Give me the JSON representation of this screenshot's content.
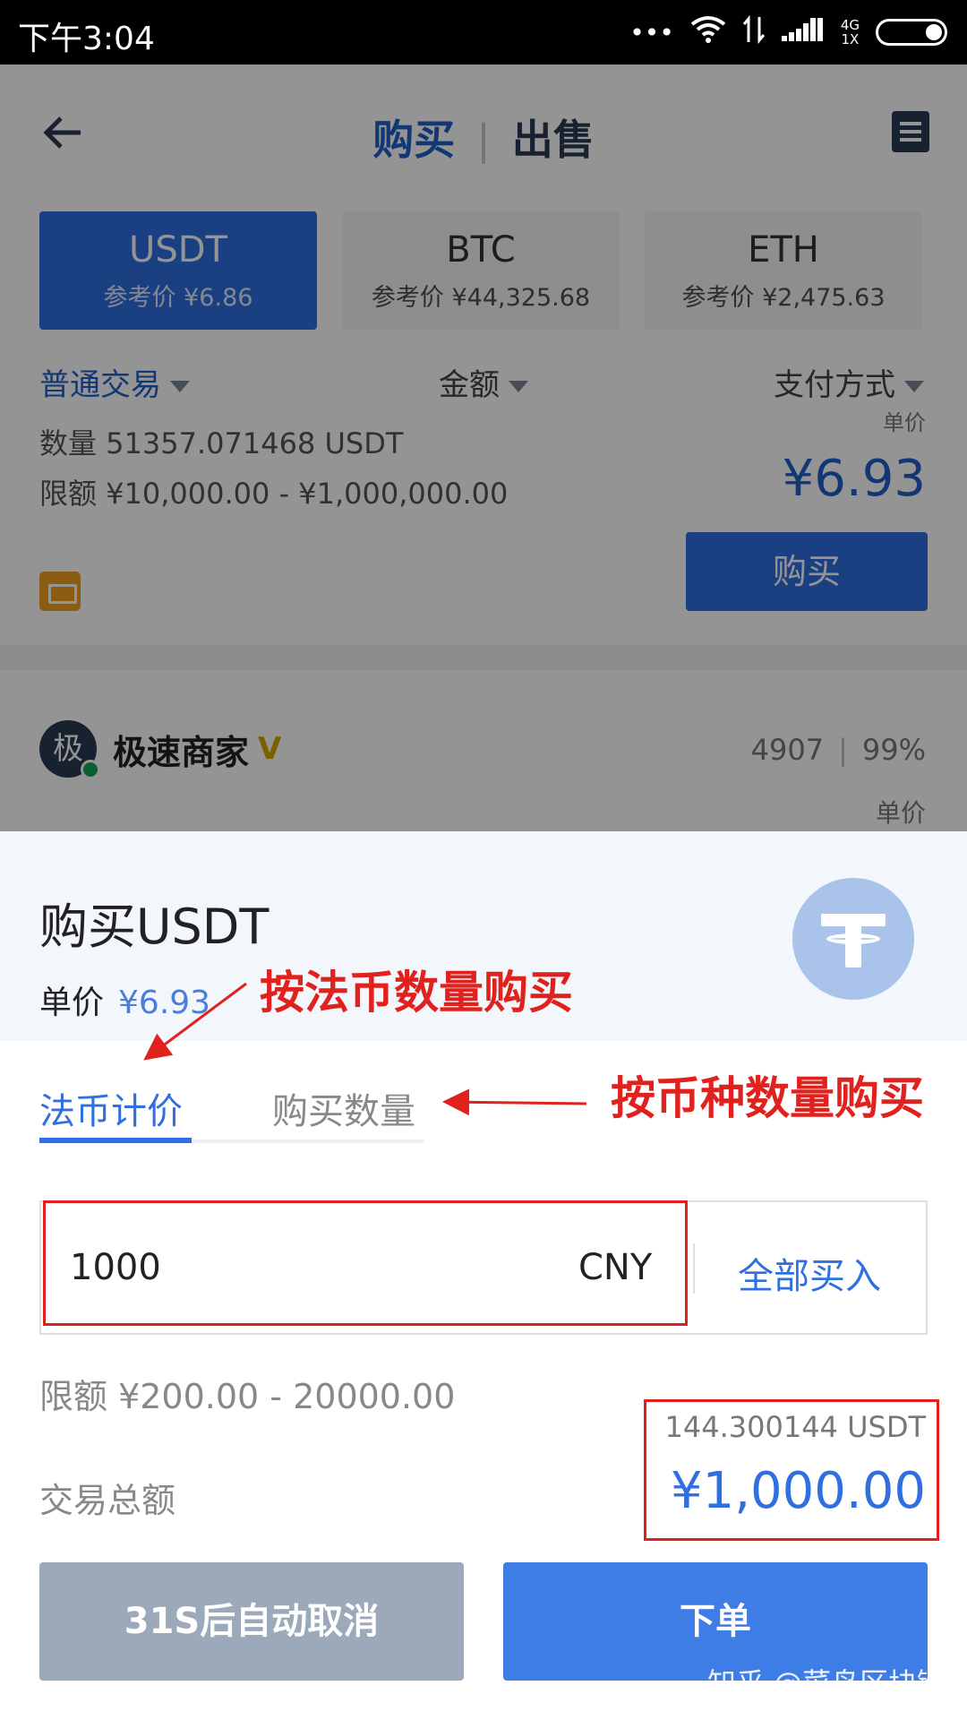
{
  "status_bar": {
    "time": "下午3:04",
    "network_top": "4G",
    "network_bottom": "1X",
    "dots": "•••"
  },
  "header": {
    "buy_tab": "购买",
    "separator": "|",
    "sell_tab": "出售"
  },
  "coins": [
    {
      "symbol": "USDT",
      "ref_price": "参考价 ¥6.86"
    },
    {
      "symbol": "BTC",
      "ref_price": "参考价 ¥44,325.68"
    },
    {
      "symbol": "ETH",
      "ref_price": "参考价 ¥2,475.63"
    }
  ],
  "filters": {
    "trade_type": "普通交易",
    "amount": "金额",
    "payment": "支付方式"
  },
  "ad": {
    "quantity": "数量 51357.071468 USDT",
    "limit": "限额 ¥10,000.00 - ¥1,000,000.00",
    "unit_label": "单价",
    "price": "¥6.93",
    "buy_button": "购买"
  },
  "merchant": {
    "avatar_char": "极",
    "name": "极速商家",
    "badge": "V",
    "orders": "4907",
    "stat_sep": "|",
    "rate": "99%",
    "unit_label": "单价"
  },
  "sheet": {
    "title": "购买USDT",
    "unit_price_label": "单价",
    "unit_price": "¥6.93",
    "tab_fiat": "法币计价",
    "tab_qty": "购买数量",
    "amount_value": "1000",
    "currency": "CNY",
    "buy_all": "全部买入",
    "limit": "限额 ¥200.00 - 20000.00",
    "usdt_amount": "144.300144 USDT",
    "total_label": "交易总额",
    "total_value": "¥1,000.00",
    "cancel_button": "31S后自动取消",
    "order_button": "下单"
  },
  "annotations": {
    "by_fiat": "按法币数量购买",
    "by_coin": "按币种数量购买"
  },
  "watermark": "知乎 @菜鸟区块链",
  "colors": {
    "accent": "#2f6fe0",
    "annotation_red": "#e0221f",
    "cancel_gray": "#9ba9bb"
  }
}
